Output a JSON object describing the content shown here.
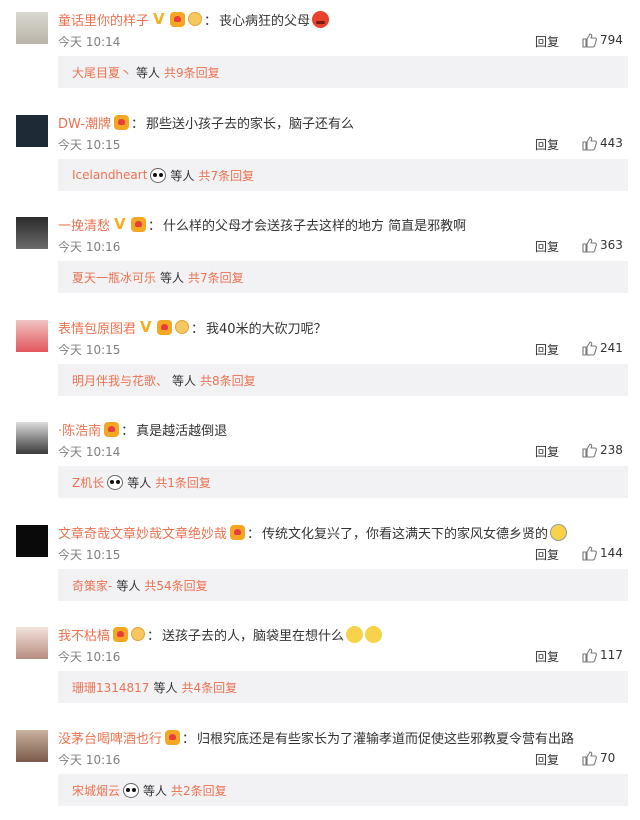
{
  "colors": {
    "link": "#eb7350",
    "subbar": "#f2f2f5",
    "vip": "#f6b01e"
  },
  "icons": {
    "verified": "V",
    "thumbs_up": "thumbs-up-icon"
  },
  "comments": [
    {
      "username": "童话里你的样子",
      "badges": [
        "verified-v",
        "vip-crown",
        "medal"
      ],
      "text": "丧心病狂的父母",
      "emoji": "angry",
      "time": "今天 10:14",
      "reply": "回复",
      "likes": "794",
      "sub_name": "大尾目夏丶",
      "sub_panda": false,
      "sub_mid": "等人",
      "sub_total": "共9条回复"
    },
    {
      "username": "DW-潮牌",
      "badges": [
        "vip-crown"
      ],
      "text": "那些送小孩子去的家长，脑子还有么",
      "emoji": "",
      "time": "今天 10:15",
      "reply": "回复",
      "likes": "443",
      "sub_name": "Icelandheart",
      "sub_panda": true,
      "sub_mid": "等人",
      "sub_total": "共7条回复"
    },
    {
      "username": "一挽清愁",
      "badges": [
        "verified-v",
        "vip-crown"
      ],
      "text": "什么样的父母才会送孩子去这样的地方 简直是邪教啊",
      "emoji": "",
      "time": "今天 10:16",
      "reply": "回复",
      "likes": "363",
      "sub_name": "夏天一瓶冰可乐",
      "sub_panda": false,
      "sub_mid": "等人",
      "sub_total": "共7条回复"
    },
    {
      "username": "表情包原图君",
      "badges": [
        "verified-v",
        "vip-crown",
        "medal"
      ],
      "text": "我40米的大砍刀呢？",
      "emoji": "",
      "time": "今天 10:15",
      "reply": "回复",
      "likes": "241",
      "sub_name": "明月伴我与花歌、",
      "sub_panda": false,
      "sub_mid": "等人",
      "sub_total": "共8条回复"
    },
    {
      "username": "·陈浩南",
      "badges": [
        "vip-crown"
      ],
      "text": "真是越活越倒退",
      "emoji": "",
      "time": "今天 10:14",
      "reply": "回复",
      "likes": "238",
      "sub_name": "Z机长",
      "sub_panda": true,
      "sub_mid": "等人",
      "sub_total": "共1条回复"
    },
    {
      "username": "文章奇哉文章妙哉文章绝妙哉",
      "badges": [
        "vip-crown"
      ],
      "text": "传统文化复兴了，你看这满天下的家风女德乡贤的",
      "emoji": "dizzy",
      "time": "今天 10:15",
      "reply": "回复",
      "likes": "144",
      "sub_name": "奇策家-",
      "sub_panda": false,
      "sub_mid": "等人",
      "sub_total": "共54条回复"
    },
    {
      "username": "我不枯槁",
      "badges": [
        "vip-crown",
        "medal"
      ],
      "text": "送孩子去的人，脑袋里在想什么",
      "emoji": "sweat2",
      "time": "今天 10:16",
      "reply": "回复",
      "likes": "117",
      "sub_name": "珊珊1314817",
      "sub_panda": false,
      "sub_mid": "等人",
      "sub_total": "共4条回复"
    },
    {
      "username": "没茅台喝啤酒也行",
      "badges": [
        "vip-crown"
      ],
      "text": "归根究底还是有些家长为了灌输孝道而促使这些邪教夏令营有出路",
      "emoji": "",
      "time": "今天 10:16",
      "reply": "回复",
      "likes": "70",
      "sub_name": "宋城烟云",
      "sub_panda": true,
      "sub_mid": "等人",
      "sub_total": "共2条回复"
    }
  ]
}
